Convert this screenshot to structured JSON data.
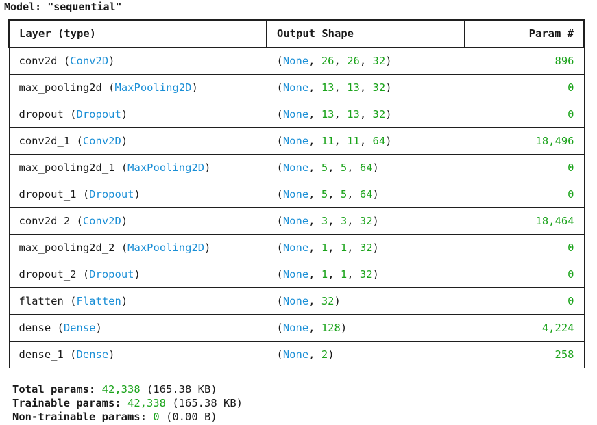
{
  "model": {
    "label": "Model:",
    "name": "\"sequential\""
  },
  "table": {
    "headers": {
      "layer": "Layer (type)",
      "output": "Output Shape",
      "param": "Param #"
    },
    "rows": [
      {
        "name": "conv2d",
        "type": "Conv2D",
        "shape": [
          "None",
          "26",
          "26",
          "32"
        ],
        "params": "896"
      },
      {
        "name": "max_pooling2d",
        "type": "MaxPooling2D",
        "shape": [
          "None",
          "13",
          "13",
          "32"
        ],
        "params": "0"
      },
      {
        "name": "dropout",
        "type": "Dropout",
        "shape": [
          "None",
          "13",
          "13",
          "32"
        ],
        "params": "0"
      },
      {
        "name": "conv2d_1",
        "type": "Conv2D",
        "shape": [
          "None",
          "11",
          "11",
          "64"
        ],
        "params": "18,496"
      },
      {
        "name": "max_pooling2d_1",
        "type": "MaxPooling2D",
        "shape": [
          "None",
          "5",
          "5",
          "64"
        ],
        "params": "0"
      },
      {
        "name": "dropout_1",
        "type": "Dropout",
        "shape": [
          "None",
          "5",
          "5",
          "64"
        ],
        "params": "0"
      },
      {
        "name": "conv2d_2",
        "type": "Conv2D",
        "shape": [
          "None",
          "3",
          "3",
          "32"
        ],
        "params": "18,464"
      },
      {
        "name": "max_pooling2d_2",
        "type": "MaxPooling2D",
        "shape": [
          "None",
          "1",
          "1",
          "32"
        ],
        "params": "0"
      },
      {
        "name": "dropout_2",
        "type": "Dropout",
        "shape": [
          "None",
          "1",
          "1",
          "32"
        ],
        "params": "0"
      },
      {
        "name": "flatten",
        "type": "Flatten",
        "shape": [
          "None",
          "32"
        ],
        "params": "0"
      },
      {
        "name": "dense",
        "type": "Dense",
        "shape": [
          "None",
          "128"
        ],
        "params": "4,224"
      },
      {
        "name": "dense_1",
        "type": "Dense",
        "shape": [
          "None",
          "2"
        ],
        "params": "258"
      }
    ]
  },
  "totals": {
    "total": {
      "label": "Total params:",
      "count": "42,338",
      "size": "(165.38 KB)"
    },
    "trainable": {
      "label": "Trainable params:",
      "count": "42,338",
      "size": "(165.38 KB)"
    },
    "non_trainable": {
      "label": "Non-trainable params:",
      "count": "0",
      "size": "(0.00 B)"
    }
  },
  "colors": {
    "type_blue": "#1b8fd6",
    "number_green": "#1aa31a",
    "text": "#1a1a1a",
    "border": "#1f1f1f"
  }
}
